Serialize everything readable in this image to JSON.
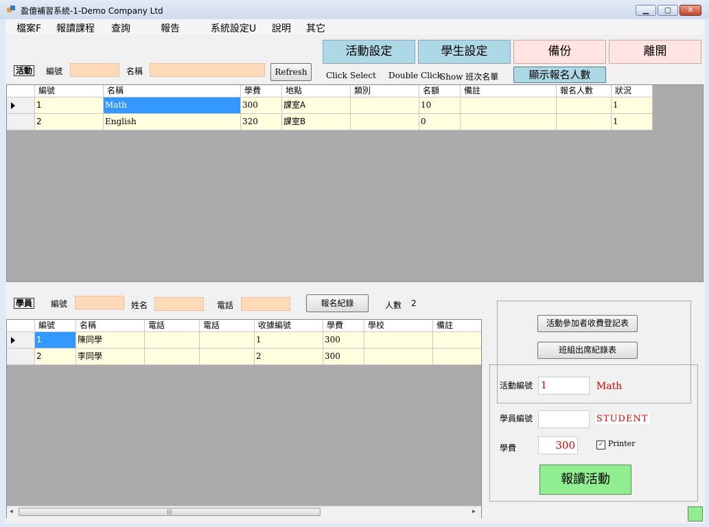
{
  "window": {
    "title": "盈億補習系統-1-Demo Company Ltd"
  },
  "menu": [
    "檔案F",
    "報讀課程",
    "查詢",
    "報告",
    "系統設定U",
    "說明",
    "其它"
  ],
  "buttons": {
    "activity_settings": "活動設定",
    "student_settings": "學生設定",
    "backup": "備份",
    "exit": "離開",
    "show_count": "顯示報名人數",
    "refresh": "Refresh",
    "reg_record": "報名紀錄",
    "fee_form": "活動參加者收費登記表",
    "attendance_form": "班組出席紀錄表",
    "enroll": "報讀活動"
  },
  "activity_filter": {
    "section_label": "活動",
    "id_label": "編號",
    "name_label": "名稱",
    "id_value": "",
    "name_value": ""
  },
  "hint": {
    "click": "Click",
    "select": "Select",
    "double_click": "Double Click",
    "show": "Show 班次名單"
  },
  "activity_grid": {
    "columns": [
      "編號",
      "名稱",
      "學費",
      "地點",
      "類別",
      "名額",
      "備註",
      "報名人數",
      "狀況"
    ],
    "rows": [
      [
        "1",
        "Math",
        "300",
        "課室A",
        "",
        "10",
        "",
        "",
        "1"
      ],
      [
        "2",
        "English",
        "320",
        "課室B",
        "",
        "0",
        "",
        "",
        "1"
      ]
    ]
  },
  "student_filter": {
    "section_label": "學員",
    "id_label": "編號",
    "name_label": "姓名",
    "phone_label": "電話",
    "count_label": "人數",
    "count_value": "2",
    "id_value": "",
    "name_value": "",
    "phone_value": ""
  },
  "student_grid": {
    "columns": [
      "編號",
      "名稱",
      "電話",
      "電話",
      "收據編號",
      "學費",
      "學校",
      "備註"
    ],
    "rows": [
      [
        "1",
        "陳同學",
        "",
        "",
        "1",
        "300",
        "",
        ""
      ],
      [
        "2",
        "李同學",
        "",
        "",
        "2",
        "300",
        "",
        ""
      ]
    ]
  },
  "enroll_panel": {
    "activity_id_label": "活動編號",
    "activity_id_value": "1",
    "activity_name": "Math",
    "student_id_label": "學員編號",
    "student_id_value": "",
    "student_tag": "STUDENT",
    "fee_label": "學費",
    "fee_value": "300",
    "printer_label": "Printer",
    "printer_checked": true
  },
  "colors": {
    "header_blue": "#add8e6",
    "header_pink": "#ffe4e1",
    "field_peach": "#ffdab9",
    "row_yellow": "#ffffe0",
    "grid_bg": "#ababab",
    "selected": "#3399ff",
    "enroll_green": "#90ee90"
  }
}
